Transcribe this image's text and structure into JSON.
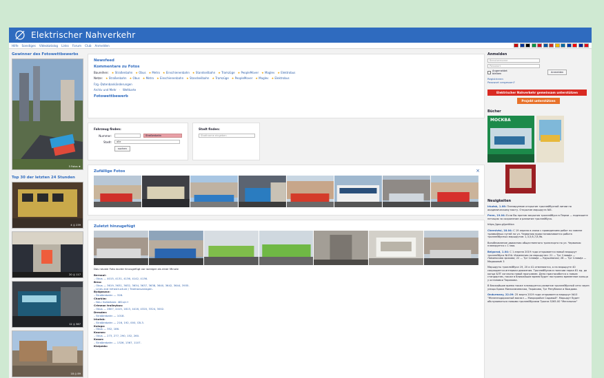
{
  "header": {
    "brand": "Elektrischer Nahverkehr"
  },
  "menu": [
    "Hilfe",
    "Sonstiges",
    "Videokatalog",
    "Links",
    "Forum",
    "Club",
    "Anmelden"
  ],
  "flag_colors": [
    "#c00",
    "#003399",
    "#000",
    "#009246",
    "#ce1126",
    "#0055a4",
    "#d52b1e",
    "#f1bf00",
    "#006aa7",
    "#0039a6",
    "#ff0000",
    "#002395",
    "#e30a17"
  ],
  "left": {
    "contest_title": "Gewinner des Fotowettbewerbs",
    "contest_caption": "5 Fotos ★",
    "top_title": "Top 30 der letzten 24 Stunden",
    "top_caps": [
      "4 ◎ 239",
      "20 ◎ 117",
      "12 ◎ 367",
      "18 ◎ 89"
    ]
  },
  "main": {
    "newsfeed": "Newsfeed",
    "comments": "Kommentare zu Fotos",
    "baureihen_label": "Baureihen:",
    "netze_label": "Netze:",
    "categories": [
      "Straßenbahn",
      "Obus",
      "Metro",
      "Einschienenbahn",
      "Standseilbahn",
      "Tramzüge",
      "PeopleMover",
      "Maglev",
      "Elektrobus"
    ],
    "ezg": "Fzg.-Datenbankänderungen",
    "archive": "Archiv und Mehr",
    "world": "Weltkarte",
    "contest": "Fotowettbewerb",
    "find_vehicle": "Fahrzeug finden:",
    "number_label": "Nummer:",
    "type_value": "Straßenbahn",
    "city_label": "Stadt:",
    "city_value": "alle",
    "search_btn": "suchen",
    "find_city": "Stadt finden:",
    "city_placeholder": "Stadtname eingeben",
    "random_title": "Zufällige Fotos",
    "close": "×",
    "recent_title": "Zuletzt hinzugefügt",
    "recent_note": "Das neuste Foto wurde hinzugefügt vor weniger als einer Minute",
    "recent_lines": [
      "Bernaul:",
      "– Obus — 4015, 4131, 4136, 4142, 4136.",
      "Brno:",
      "– Obus — 3619, 3631, 3632, 3634, 3637, 3638, 3640, 3642, 3644, 3935.",
      "– Lines and Infrastructure / Traktionsanlagen.",
      "Bydgoszcz:",
      "– Straßenbahn — 328.",
      "Charkiw:",
      "– Neu: Kollwitzstr. 481s/n+",
      "Crimean trolleybus:",
      "– Obus — 2607, 4415, 1813, 4416, 4320, 3324, 3002.",
      "Dresden:",
      "– Straßenbahn — 1018.",
      "Irkutsk:",
      "– Straßenbahn — 216, 192, 000, CB-3.",
      "Kaluga:",
      "– Obus — 352, 186.",
      "Kaunas:",
      "– Obus — 273, 277, 290, 152, 260.",
      "Kasan:",
      "– Straßenbahn — 1326, 1367, 1107.",
      "Klaipeda:"
    ]
  },
  "right": {
    "login_title": "Anmelden",
    "user_placeholder": "Benutzername",
    "pass_placeholder": "Passwort",
    "remember": "Angemeldet bleiben",
    "login_btn": "Anmelden",
    "register": "Registrieren",
    "forgot": "Passwort vergessen?",
    "support": "Elektrischer Nahverkehr gemeinsam unterstützen",
    "project": "Projekt unterstützen",
    "books_title": "Bücher",
    "book_title": "МОСКВА",
    "news_title": "Neuigkeiten",
    "news": [
      {
        "head": "Irkutsk, 1.08:",
        "body": "Планируемое открытие троллейбусной линии по академическому мосту. Открытие маршрута №5."
      },
      {
        "head": "Perm, 19.04:",
        "body": "Если Вы против закрытия троллейбуса в Перми — подпишите петицию за сохранение и развитие троллейбуса."
      },
      {
        "head": "",
        "body": "https://goo.gl/petition"
      },
      {
        "head": "Chernivtsi, 18.04:",
        "body": "С 19 апреля в связи с проведением работ по замене трамвайных путей на ул. Червоною приостанавливается работа троллейбусных маршрутов: 1,3,5,6,7,8,9b."
      },
      {
        "head": "",
        "body": "Возобновление движения общественного транспорта по ул. Червоною планируется с 1 мая."
      },
      {
        "head": "Belgorod, 1.04:",
        "body": "С 1 апреля 2019 года открывается новый маршрут троллейбуса №15А. Изменения на маршрутах: 21 — Трг Славија — Ломиносова зрикова; 22 — Трг Славија — Крушевачка; 28 — Трг Славија — Медаковић 3"
      },
      {
        "head": "",
        "body": "Маршруты троллейбуса 19, 20 и 41 отменяются, а на маршруте 40 сокращается интервал движения. Троллейбусов в наличии парка 81 ед. до конца БЛТ согласно новой программе. Депо приспособится к новым стандартам, также в ближайшие время будет построено временное кольцо у остановки Тюрикова."
      },
      {
        "head": "",
        "body": "В ближайшие время также планируется развитие троллейбусной сети через улицы Брака Милосавчевичаа, Тюрикова, Трг Републике и Вождова."
      },
      {
        "head": "Ondurmany, 22.09:",
        "body": "25 марта 2019 года открывается маршрут №10 \"Железнодорожный вокзал — Микрорайон Садовый\". Маршрут будет обслуживаться новыми троллейбусами Тролза 5265.00 \"Мегаполис\""
      }
    ]
  }
}
